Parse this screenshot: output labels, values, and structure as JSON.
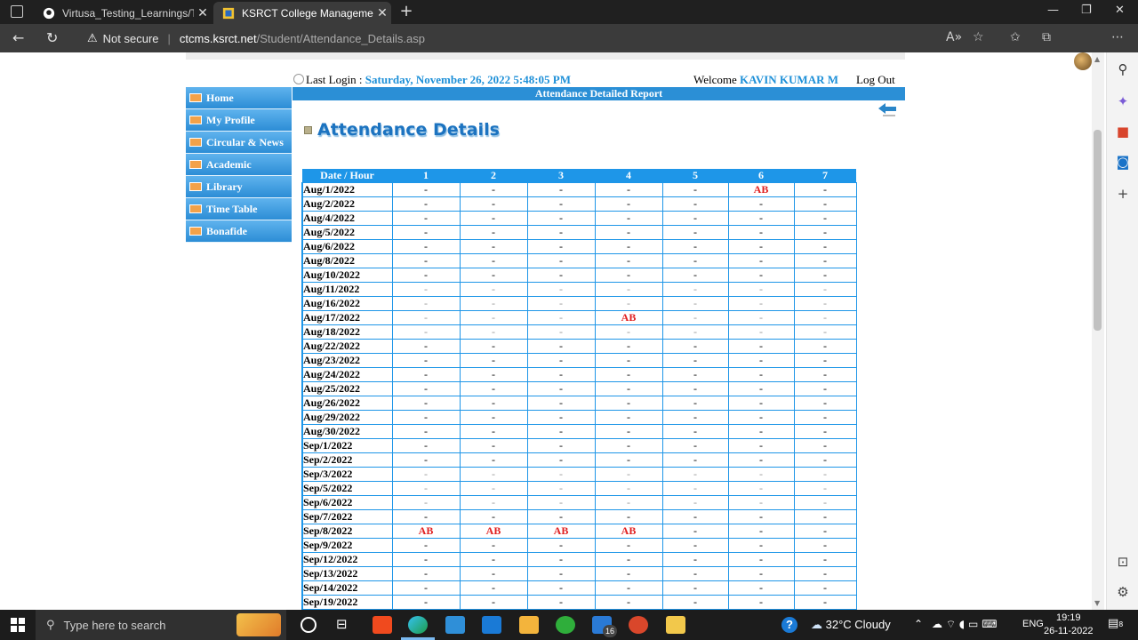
{
  "browser": {
    "tabs": [
      {
        "title": "Virtusa_Testing_Learnings/Testca",
        "icon": "github-icon"
      },
      {
        "title": "KSRCT College Management Sys",
        "icon": "site-icon"
      }
    ],
    "security": "Not secure",
    "url_host": "ctcms.ksrct.net",
    "url_path": "/Student/Attendance_Details.asp"
  },
  "header": {
    "last_login_label": "Last Login : ",
    "last_login_value": "Saturday, November 26, 2022 5:48:05 PM",
    "welcome_label": "Welcome ",
    "user_name": "KAVIN KUMAR M",
    "logout": "Log Out",
    "report_title": "Attendance Detailed Report"
  },
  "menu": [
    "Home",
    "My Profile",
    "Circular & News",
    "Academic",
    "Library",
    "Time Table",
    "Bonafide"
  ],
  "page_title": "Attendance Details",
  "table": {
    "headers": [
      "Date / Hour",
      "1",
      "2",
      "3",
      "4",
      "5",
      "6",
      "7"
    ],
    "rows": [
      {
        "date": "Aug/1/2022",
        "cells": [
          "-",
          "-",
          "-",
          "-",
          "-",
          "AB",
          "-"
        ]
      },
      {
        "date": "Aug/2/2022",
        "cells": [
          "-",
          "-",
          "-",
          "-",
          "-",
          "-",
          "-"
        ]
      },
      {
        "date": "Aug/4/2022",
        "cells": [
          "-",
          "-",
          "-",
          "-",
          "-",
          "-",
          "-"
        ]
      },
      {
        "date": "Aug/5/2022",
        "cells": [
          "-",
          "-",
          "-",
          "-",
          "-",
          "-",
          "-"
        ]
      },
      {
        "date": "Aug/6/2022",
        "cells": [
          "-",
          "-",
          "-",
          "-",
          "-",
          "-",
          "-"
        ]
      },
      {
        "date": "Aug/8/2022",
        "cells": [
          "-",
          "-",
          "-",
          "-",
          "-",
          "-",
          "-"
        ]
      },
      {
        "date": "Aug/10/2022",
        "cells": [
          "-",
          "-",
          "-",
          "-",
          "-",
          "-",
          "-"
        ]
      },
      {
        "date": "Aug/11/2022",
        "cells": [
          "-",
          "-",
          "-",
          "-",
          "-",
          "-",
          "-"
        ]
      },
      {
        "date": "Aug/16/2022",
        "cells": [
          "-",
          "-",
          "-",
          "-",
          "-",
          "-",
          "-"
        ]
      },
      {
        "date": "Aug/17/2022",
        "cells": [
          "-",
          "-",
          "-",
          "AB",
          "-",
          "-",
          "-"
        ]
      },
      {
        "date": "Aug/18/2022",
        "cells": [
          "-",
          "-",
          "-",
          "-",
          "-",
          "-",
          "-"
        ]
      },
      {
        "date": "Aug/22/2022",
        "cells": [
          "-",
          "-",
          "-",
          "-",
          "-",
          "-",
          "-"
        ]
      },
      {
        "date": "Aug/23/2022",
        "cells": [
          "-",
          "-",
          "-",
          "-",
          "-",
          "-",
          "-"
        ]
      },
      {
        "date": "Aug/24/2022",
        "cells": [
          "-",
          "-",
          "-",
          "-",
          "-",
          "-",
          "-"
        ]
      },
      {
        "date": "Aug/25/2022",
        "cells": [
          "-",
          "-",
          "-",
          "-",
          "-",
          "-",
          "-"
        ]
      },
      {
        "date": "Aug/26/2022",
        "cells": [
          "-",
          "-",
          "-",
          "-",
          "-",
          "-",
          "-"
        ]
      },
      {
        "date": "Aug/29/2022",
        "cells": [
          "-",
          "-",
          "-",
          "-",
          "-",
          "-",
          "-"
        ]
      },
      {
        "date": "Aug/30/2022",
        "cells": [
          "-",
          "-",
          "-",
          "-",
          "-",
          "-",
          "-"
        ]
      },
      {
        "date": "Sep/1/2022",
        "cells": [
          "-",
          "-",
          "-",
          "-",
          "-",
          "-",
          "-"
        ]
      },
      {
        "date": "Sep/2/2022",
        "cells": [
          "-",
          "-",
          "-",
          "-",
          "-",
          "-",
          "-"
        ]
      },
      {
        "date": "Sep/3/2022",
        "cells": [
          "-",
          "-",
          "-",
          "-",
          "-",
          "-",
          "-"
        ]
      },
      {
        "date": "Sep/5/2022",
        "cells": [
          "-",
          "-",
          "-",
          "-",
          "-",
          "-",
          "-"
        ]
      },
      {
        "date": "Sep/6/2022",
        "cells": [
          "-",
          "-",
          "-",
          "-",
          "-",
          "-",
          "-"
        ]
      },
      {
        "date": "Sep/7/2022",
        "cells": [
          "-",
          "-",
          "-",
          "-",
          "-",
          "-",
          "-"
        ]
      },
      {
        "date": "Sep/8/2022",
        "cells": [
          "AB",
          "AB",
          "AB",
          "AB",
          "-",
          "-",
          "-"
        ]
      },
      {
        "date": "Sep/9/2022",
        "cells": [
          "-",
          "-",
          "-",
          "-",
          "-",
          "-",
          "-"
        ]
      },
      {
        "date": "Sep/12/2022",
        "cells": [
          "-",
          "-",
          "-",
          "-",
          "-",
          "-",
          "-"
        ]
      },
      {
        "date": "Sep/13/2022",
        "cells": [
          "-",
          "-",
          "-",
          "-",
          "-",
          "-",
          "-"
        ]
      },
      {
        "date": "Sep/14/2022",
        "cells": [
          "-",
          "-",
          "-",
          "-",
          "-",
          "-",
          "-"
        ]
      },
      {
        "date": "Sep/19/2022",
        "cells": [
          "-",
          "-",
          "-",
          "-",
          "-",
          "-",
          "-"
        ]
      }
    ],
    "light_rows": [
      7,
      8,
      9,
      10,
      20,
      21,
      22
    ]
  },
  "taskbar": {
    "search_placeholder": "Type here to search",
    "weather": "32°C  Cloudy",
    "language": "ENG",
    "time": "19:19",
    "date": "26-11-2022",
    "mail_badge": "16",
    "notification_badge": "8"
  },
  "colors": {
    "accent": "#1e96e8",
    "absent": "#e02020",
    "link": "#1e90d8"
  }
}
